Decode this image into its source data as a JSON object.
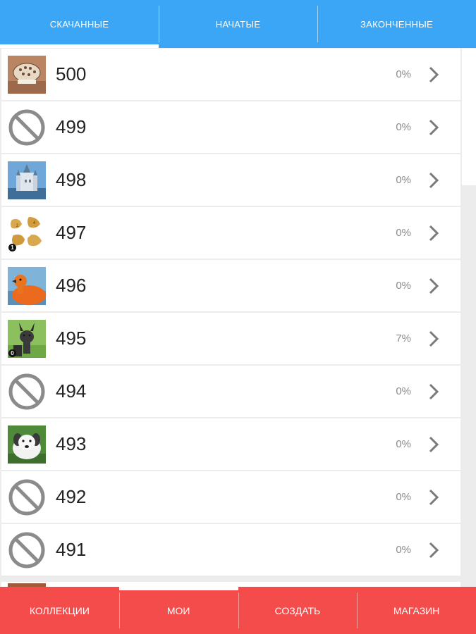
{
  "top_tabs": [
    {
      "label": "СКАЧАННЫЕ",
      "active": true
    },
    {
      "label": "НАЧАТЫЕ",
      "active": false
    },
    {
      "label": "ЗАКОНЧЕННЫЕ",
      "active": false
    }
  ],
  "items": [
    {
      "number": "500",
      "progress": "0%",
      "thumb": "lamp-thumbnail"
    },
    {
      "number": "499",
      "progress": "0%",
      "thumb": "unavailable-icon"
    },
    {
      "number": "498",
      "progress": "0%",
      "thumb": "castle-thumbnail"
    },
    {
      "number": "497",
      "progress": "0%",
      "thumb": "puzzle-pieces-thumbnail"
    },
    {
      "number": "496",
      "progress": "0%",
      "thumb": "duck-thumbnail"
    },
    {
      "number": "495",
      "progress": "7%",
      "thumb": "okapi-thumbnail"
    },
    {
      "number": "494",
      "progress": "0%",
      "thumb": "unavailable-icon"
    },
    {
      "number": "493",
      "progress": "0%",
      "thumb": "dog-thumbnail"
    },
    {
      "number": "492",
      "progress": "0%",
      "thumb": "unavailable-icon"
    },
    {
      "number": "491",
      "progress": "0%",
      "thumb": "unavailable-icon"
    }
  ],
  "bottom_nav": [
    {
      "label": "КОЛЛЕКЦИИ",
      "active": false
    },
    {
      "label": "МОИ",
      "active": true
    },
    {
      "label": "СОЗДАТЬ",
      "active": false
    },
    {
      "label": "МАГАЗИН",
      "active": false
    }
  ],
  "colors": {
    "top_bar": "#3aa6f5",
    "bottom_bar": "#f44b4b",
    "progress_text": "#8a8a8a",
    "chevron": "#7a7a7a"
  },
  "icons": {
    "chevron": "chevron-right-icon",
    "unavailable": "prohibited-icon"
  }
}
